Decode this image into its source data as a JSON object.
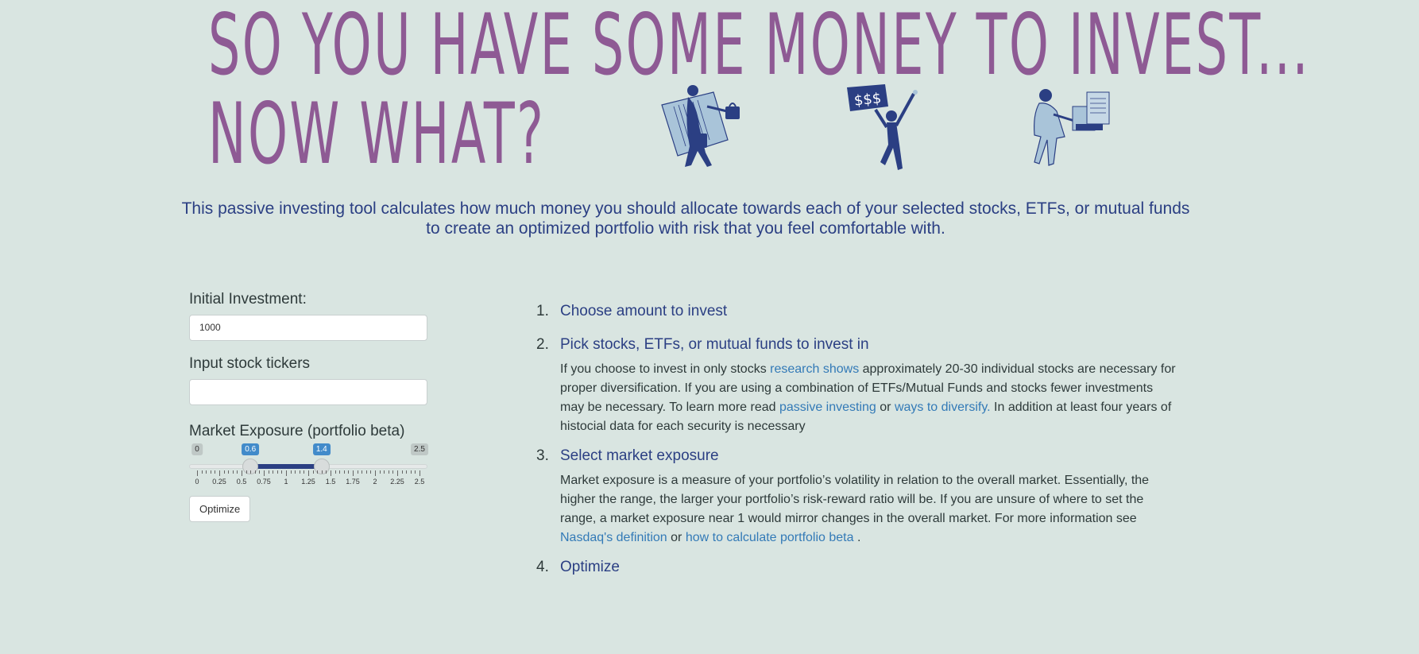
{
  "hero": {
    "line1": "SO YOU HAVE SOME MONEY TO INVEST...",
    "line2": "NOW WHAT?",
    "illustration_sign": "$$$"
  },
  "subtitle": {
    "line1": "This passive investing tool calculates how much money you should allocate towards each of your selected stocks, ETFs, or mutual funds",
    "line2": "to create an optimized portfolio with risk that you feel comfortable with."
  },
  "form": {
    "investment_label": "Initial Investment:",
    "investment_value": "1000",
    "tickers_label": "Input stock tickers",
    "tickers_value": "",
    "exposure_label": "Market Exposure (portfolio beta)",
    "slider": {
      "min": 0,
      "max": 2.5,
      "low": 0.6,
      "high": 1.4,
      "min_label": "0",
      "max_label": "2.5",
      "low_label": "0.6",
      "high_label": "1.4",
      "tick_labels": [
        "0",
        "0.25",
        "0.5",
        "0.75",
        "1",
        "1.25",
        "1.5",
        "1.75",
        "2",
        "2.25",
        "2.5"
      ]
    },
    "optimize_button": "Optimize"
  },
  "steps": [
    {
      "num": "1.",
      "title": "Choose amount to invest"
    },
    {
      "num": "2.",
      "title": "Pick stocks, ETFs, or mutual funds to invest in",
      "body": [
        "If you choose to invest in only stocks ",
        "research shows",
        " approximately 20-30 individual stocks are necessary for proper diversification. If you are using a combination of ETFs/Mutual Funds and stocks fewer investments may be necessary. To learn more read ",
        "passive investing",
        " or ",
        "ways to diversify.",
        " In addition at least four years of histocial data for each security is necessary"
      ]
    },
    {
      "num": "3.",
      "title": "Select market exposure",
      "body": [
        "Market exposure is a measure of your portfolio’s volatility in relation to the overall market. Essentially, the higher the range, the larger your portfolio’s risk-reward ratio will be. If you are unsure of where to set the range, a market exposure near 1 would mirror changes in the overall market. For more information see ",
        "Nasdaq's definition",
        " or ",
        "how to calculate portfolio beta",
        " ."
      ]
    },
    {
      "num": "4.",
      "title": "Optimize"
    }
  ],
  "colors": {
    "background": "#d9e5e1",
    "title": "#8e5a94",
    "accent": "#2b3f83",
    "link": "#337ab7",
    "illustration_light": "#a9c4d9",
    "illustration_dark": "#2b3f83"
  }
}
